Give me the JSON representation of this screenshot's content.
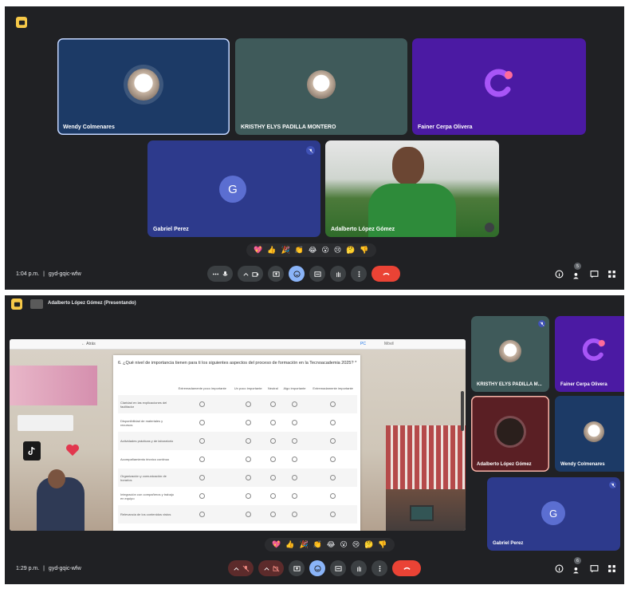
{
  "screen1": {
    "participants": [
      {
        "name": "Wendy Colmenares",
        "tile_color": "#1c3a66",
        "avatar": "photo"
      },
      {
        "name": "KRISTHY ELYS PADILLA MONTERO",
        "tile_color": "#3f5a5a",
        "avatar": "photo"
      },
      {
        "name": "Fainer Cerpa Olivera",
        "tile_color": "#4b1aa3",
        "avatar": "logo"
      },
      {
        "name": "Gabriel Perez",
        "tile_color": "#2d3a8c",
        "avatar_letter": "G"
      },
      {
        "name": "Adalberto López Gómez",
        "tile_color": "#4c7a3a",
        "avatar": "video"
      }
    ],
    "meeting_time": "1:04 p.m.",
    "meeting_separator": "|",
    "meeting_code": "gyd-gqic-wfw",
    "participant_count": "5"
  },
  "screen2": {
    "presenting_label": "Adalberto López Gómez (Presentando)",
    "shared": {
      "back_link": "← Atrás",
      "pc_link": "PC",
      "mobile_link": "Móvil",
      "question": "6. ¿Qué nivel de importancia tienen para ti los siguientes aspectos del proceso de formación en la Tecnoacademia 2025? *",
      "columns": [
        "Extremadamente poco importante",
        "Un poco importante",
        "Neutral",
        "Algo importante",
        "Extremadamente importante"
      ],
      "rows": [
        "Claridad en las explicaciones del facilitador",
        "Disponibilidad de materiales y recursos",
        "Actividades prácticas y de laboratorio",
        "Acompañamiento técnico continuo",
        "Organización y comunicación de horarios",
        "Integración con compañeros y trabajo en equipo",
        "Relevancia de los contenidos vistos"
      ]
    },
    "side_participants": [
      {
        "name": "KRISTHY ELYS PADILLA M..."
      },
      {
        "name": "Fainer Cerpa Olivera"
      },
      {
        "name": "Adalberto López Gómez"
      },
      {
        "name": "Wendy Colmenares"
      },
      {
        "name": "Gabriel Perez",
        "avatar_letter": "G"
      }
    ],
    "meeting_time": "1:29 p.m.",
    "meeting_separator": "|",
    "meeting_code": "gyd-gqic-wfw",
    "participant_count": "6"
  },
  "reactions": [
    "💖",
    "👍",
    "🎉",
    "👏",
    "😂",
    "😮",
    "😢",
    "🤔",
    "👎"
  ],
  "colors": {
    "meet_bg": "#202124",
    "control_bg": "#3c4043",
    "leave_red": "#ea4335",
    "active_blue": "#8ab4f8"
  }
}
